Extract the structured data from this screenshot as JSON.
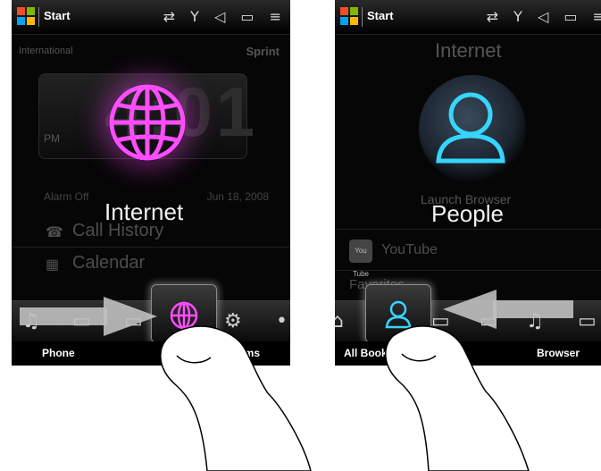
{
  "left_screen": {
    "titlebar": {
      "start_label": "Start",
      "status_icons": "⇄ Y ◁ ▭ ≡"
    },
    "carrier_left": "International",
    "carrier_right": "Sprint",
    "clock_digits": "4:01",
    "clock_ampm": "PM",
    "alarm_label": "Alarm Off",
    "date": "Jun 18, 2008",
    "menu_items": [
      "Call History",
      "Calendar"
    ],
    "overlay_title": "Internet",
    "softkeys": {
      "left": "Phone",
      "right": "Programs"
    }
  },
  "right_screen": {
    "titlebar": {
      "start_label": "Start",
      "status_icons": "⇄ Y ◁ ▭ ≡"
    },
    "header_title": "Internet",
    "launch_browser_label": "Launch Browser",
    "youtube_label": "YouTube",
    "youtube_icon_text": "You Tube",
    "favorites_label": "Favorites",
    "overlay_title": "People",
    "softkeys": {
      "left": "All Bookmarks",
      "right": "Browser"
    }
  },
  "colors": {
    "globe_magenta": "#ff4dff",
    "people_cyan": "#35d6ff",
    "arrow_gray": "#c0c0c0"
  }
}
